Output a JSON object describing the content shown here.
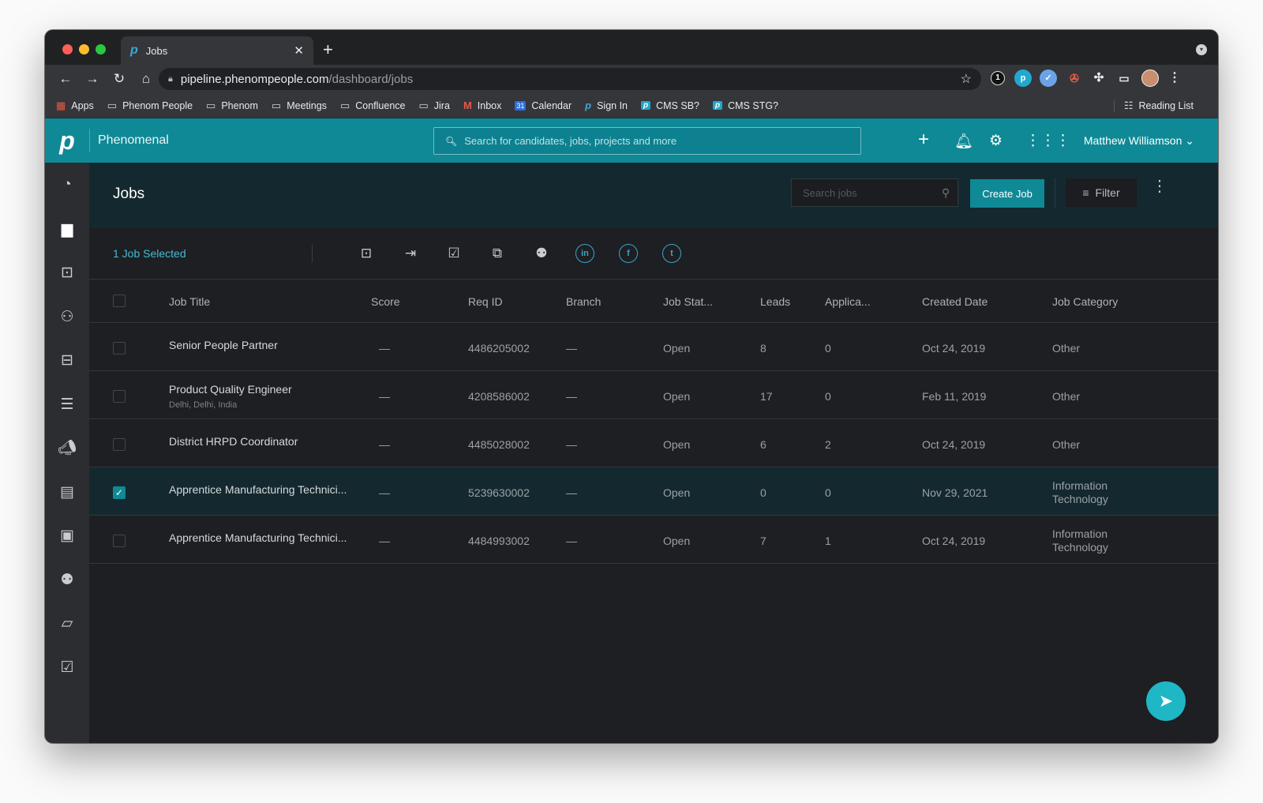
{
  "browser": {
    "tab_title": "Jobs",
    "url_domain": "pipeline.phenompeople.com",
    "url_path": "/dashboard/jobs",
    "bookmarks": [
      {
        "label": "Apps",
        "icon": "apps-grid-icon"
      },
      {
        "label": "Phenom People",
        "icon": "folder-icon"
      },
      {
        "label": "Phenom",
        "icon": "folder-icon"
      },
      {
        "label": "Meetings",
        "icon": "folder-icon"
      },
      {
        "label": "Confluence",
        "icon": "folder-icon"
      },
      {
        "label": "Jira",
        "icon": "folder-icon"
      },
      {
        "label": "Inbox",
        "icon": "gmail-icon"
      },
      {
        "label": "Calendar",
        "icon": "calendar-icon"
      },
      {
        "label": "Sign In",
        "icon": "phenom-icon"
      },
      {
        "label": "CMS SB?",
        "icon": "phenom-badge-icon"
      },
      {
        "label": "CMS STG?",
        "icon": "phenom-badge-icon"
      }
    ],
    "reading_list": "Reading List"
  },
  "app": {
    "name": "Phenomenal",
    "search_placeholder": "Search for candidates, jobs, projects and more",
    "user_name": "Matthew Williamson",
    "accent": "#0f8996"
  },
  "page": {
    "title": "Jobs",
    "search_placeholder": "Search jobs",
    "create_label": "Create Job",
    "filter_label": "Filter",
    "selected_text": "1 Job Selected"
  },
  "table": {
    "headers": [
      "Job Title",
      "Score",
      "Req ID",
      "Branch",
      "Job Stat...",
      "Leads",
      "Applica...",
      "Created Date",
      "Job Category"
    ],
    "rows": [
      {
        "title": "Senior People Partner",
        "location": "",
        "score": "—",
        "req_id": "4486205002",
        "branch": "—",
        "status": "Open",
        "leads": "8",
        "applicants": "0",
        "created": "Oct 24, 2019",
        "category": "Other",
        "selected": false
      },
      {
        "title": "Product Quality Engineer",
        "location": "Delhi, Delhi, India",
        "score": "—",
        "req_id": "4208586002",
        "branch": "—",
        "status": "Open",
        "leads": "17",
        "applicants": "0",
        "created": "Feb 11, 2019",
        "category": "Other",
        "selected": false
      },
      {
        "title": "District HRPD Coordinator",
        "location": "",
        "score": "—",
        "req_id": "4485028002",
        "branch": "—",
        "status": "Open",
        "leads": "6",
        "applicants": "2",
        "created": "Oct 24, 2019",
        "category": "Other",
        "selected": false
      },
      {
        "title": "Apprentice Manufacturing Technici...",
        "location": "",
        "score": "—",
        "req_id": "5239630002",
        "branch": "—",
        "status": "Open",
        "leads": "0",
        "applicants": "0",
        "created": "Nov 29, 2021",
        "category": "Information Technology",
        "selected": true
      },
      {
        "title": "Apprentice Manufacturing Technici...",
        "location": "",
        "score": "—",
        "req_id": "4484993002",
        "branch": "—",
        "status": "Open",
        "leads": "7",
        "applicants": "1",
        "created": "Oct 24, 2019",
        "category": "Information Technology",
        "selected": false
      }
    ]
  }
}
